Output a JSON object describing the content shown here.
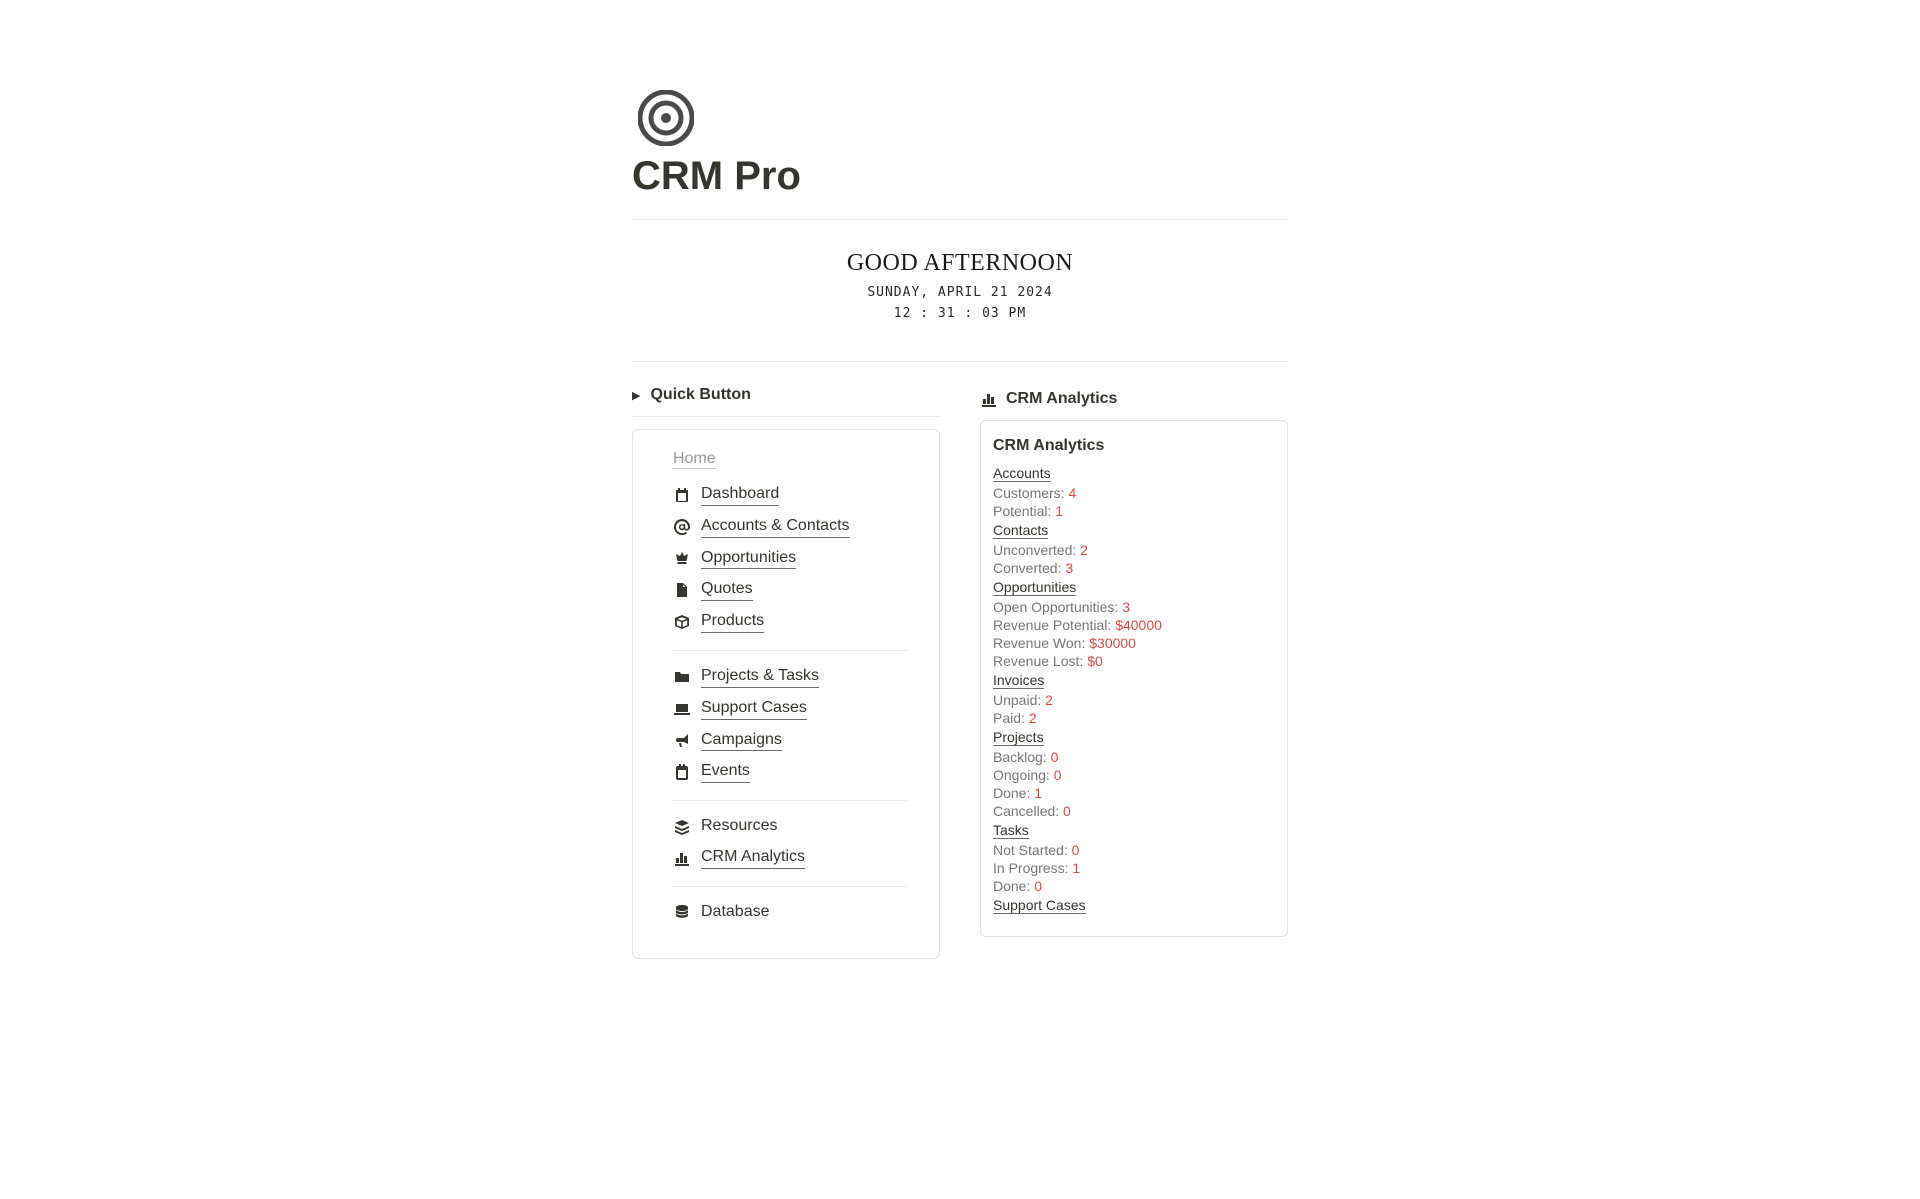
{
  "header": {
    "title": "CRM Pro"
  },
  "greeting": {
    "text": "GOOD AFTERNOON",
    "date": "SUNDAY, APRIL 21 2024",
    "time": "12 : 31 : 03 PM"
  },
  "quickButton": {
    "label": "Quick Button"
  },
  "nav": {
    "homeLabel": "Home",
    "group1": [
      {
        "label": "Dashboard"
      },
      {
        "label": "Accounts & Contacts"
      },
      {
        "label": "Opportunities"
      },
      {
        "label": "Quotes"
      },
      {
        "label": "Products"
      }
    ],
    "group2": [
      {
        "label": "Projects & Tasks"
      },
      {
        "label": "Support Cases"
      },
      {
        "label": "Campaigns"
      },
      {
        "label": "Events"
      }
    ],
    "group3": [
      {
        "label": "Resources"
      },
      {
        "label": "CRM Analytics"
      }
    ],
    "group4": [
      {
        "label": "Database"
      }
    ]
  },
  "analytics": {
    "headerLabel": "CRM Analytics",
    "cardTitle": "CRM Analytics",
    "sections": {
      "accounts": {
        "label": "Accounts",
        "customersLabel": "Customers:",
        "customers": "4",
        "potentialLabel": "Potential:",
        "potential": "1"
      },
      "contacts": {
        "label": "Contacts",
        "unconvertedLabel": "Unconverted:",
        "unconverted": "2",
        "convertedLabel": "Converted:",
        "converted": "3"
      },
      "opportunities": {
        "label": "Opportunities",
        "openLabel": "Open Opportunities:",
        "open": "3",
        "revPotentialLabel": "Revenue Potential:",
        "revPotential": "$40000",
        "revWonLabel": "Revenue Won:",
        "revWon": "$30000",
        "revLostLabel": "Revenue Lost:",
        "revLost": "$0"
      },
      "invoices": {
        "label": "Invoices",
        "unpaidLabel": "Unpaid:",
        "unpaid": "2",
        "paidLabel": "Paid:",
        "paid": "2"
      },
      "projects": {
        "label": "Projects",
        "backlogLabel": "Backlog:",
        "backlog": "0",
        "ongoingLabel": "Ongoing:",
        "ongoing": "0",
        "doneLabel": "Done:",
        "done": "1",
        "cancelledLabel": "Cancelled:",
        "cancelled": "0"
      },
      "tasks": {
        "label": "Tasks",
        "notStartedLabel": "Not Started:",
        "notStarted": "0",
        "inProgressLabel": "In Progress:",
        "inProgress": "1",
        "doneLabel": "Done:",
        "done": "0"
      },
      "supportCases": {
        "label": "Support Cases"
      }
    }
  }
}
